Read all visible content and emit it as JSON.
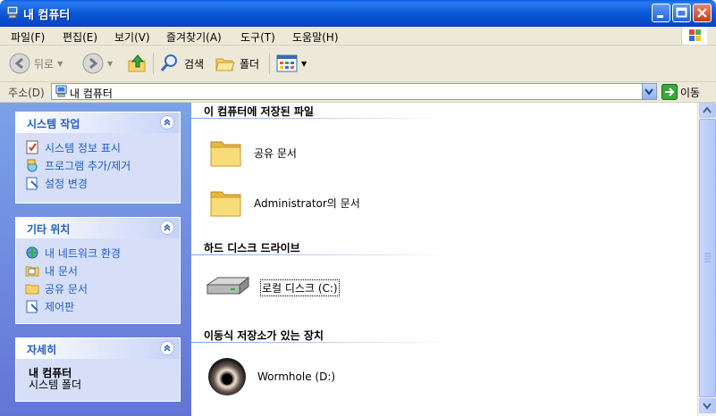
{
  "window": {
    "title": "내 컴퓨터"
  },
  "menu": [
    "파일(F)",
    "편집(E)",
    "보기(V)",
    "즐겨찾기(A)",
    "도구(T)",
    "도움말(H)"
  ],
  "toolbar": {
    "back": "뒤로",
    "search": "검색",
    "folders": "폴더"
  },
  "address": {
    "label": "주소(D)",
    "value": "내 컴퓨터",
    "go": "이동"
  },
  "panels": {
    "system": {
      "title": "시스템 작업",
      "items": [
        "시스템 정보 표시",
        "프로그램 추가/제거",
        "설정 변경"
      ]
    },
    "other": {
      "title": "기타 위치",
      "items": [
        "내 네트워크 환경",
        "내 문서",
        "공유 문서",
        "제어판"
      ]
    },
    "details": {
      "title": "자세히",
      "name": "내 컴퓨터",
      "type": "시스템 폴더"
    }
  },
  "groups": {
    "stored": {
      "title": "이 컴퓨터에 저장된 파일",
      "items": [
        "공유 문서",
        "Administrator의 문서"
      ]
    },
    "hdd": {
      "title": "하드 디스크 드라이브",
      "items": [
        "로컬 디스크 (C:)"
      ]
    },
    "removable": {
      "title": "이동식 저장소가 있는 장치",
      "items": [
        "Wormhole (D:)"
      ]
    }
  }
}
